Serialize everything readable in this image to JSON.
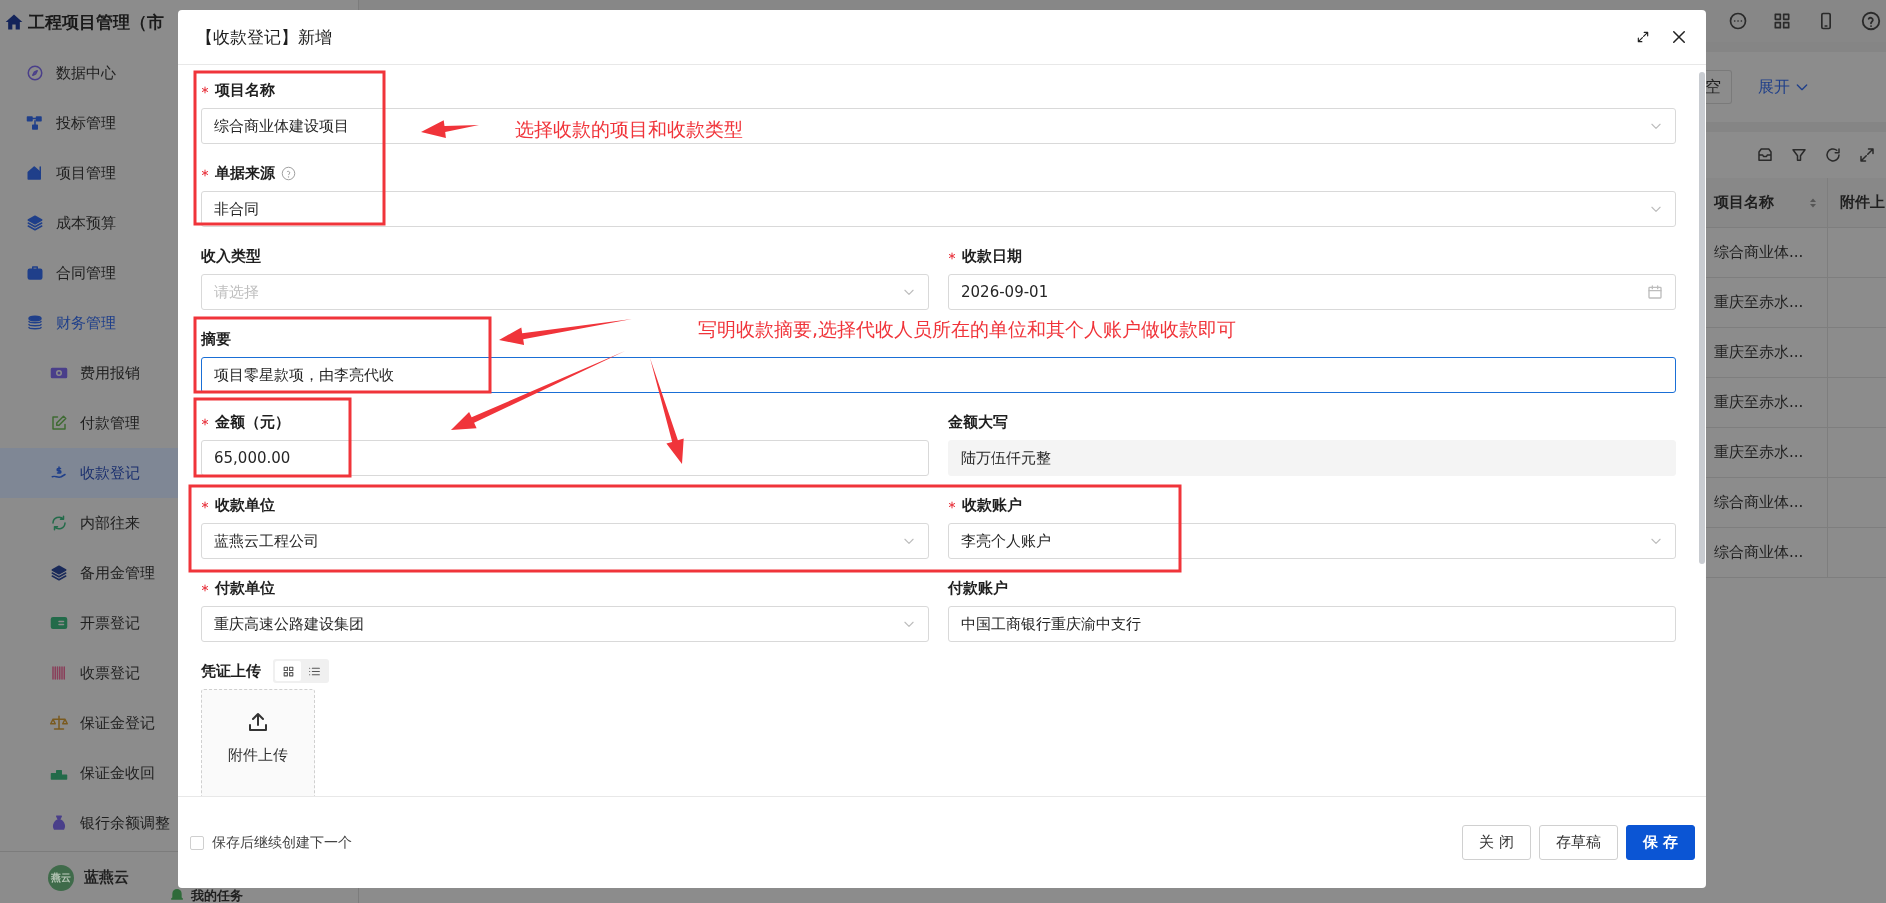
{
  "app": {
    "title": "工程项目管理（市",
    "nav": [
      {
        "label": "数据中心",
        "expanded": false,
        "selected": false
      },
      {
        "label": "投标管理",
        "expanded": false,
        "selected": false
      },
      {
        "label": "项目管理",
        "expanded": false,
        "selected": false
      },
      {
        "label": "成本预算",
        "expanded": false,
        "selected": false
      },
      {
        "label": "合同管理",
        "expanded": false,
        "selected": false
      },
      {
        "label": "财务管理",
        "expanded": true,
        "selected": false,
        "children": [
          {
            "label": "费用报销",
            "selected": false
          },
          {
            "label": "付款管理",
            "selected": false
          },
          {
            "label": "收款登记",
            "selected": true
          },
          {
            "label": "内部往来",
            "selected": false
          },
          {
            "label": "备用金管理",
            "selected": false
          },
          {
            "label": "开票登记",
            "selected": false
          },
          {
            "label": "收票登记",
            "selected": false
          },
          {
            "label": "保证金登记",
            "selected": false
          },
          {
            "label": "保证金收回",
            "selected": false
          },
          {
            "label": "银行余额调整",
            "selected": false
          }
        ]
      }
    ],
    "user": {
      "avatar": "燕云",
      "name": "蓝燕云"
    },
    "tasks_link": "我的任务"
  },
  "background_page": {
    "filter_button": "空",
    "expand_link": "展开",
    "table": {
      "columns": [
        {
          "label": "项目名称",
          "sortable": true
        },
        {
          "label": "附件上"
        }
      ],
      "rows": [
        [
          "综合商业体..."
        ],
        [
          "重庆至赤水..."
        ],
        [
          "重庆至赤水..."
        ],
        [
          "重庆至赤水..."
        ],
        [
          "重庆至赤水..."
        ],
        [
          "综合商业体..."
        ],
        [
          "综合商业体..."
        ]
      ]
    }
  },
  "dialog": {
    "title": "【收款登记】新增",
    "fields": [
      {
        "label": "项目名称",
        "required": true,
        "help": false,
        "kind": "select",
        "wide": true,
        "focused": false,
        "value": "综合商业体建设项目"
      },
      {
        "label": "单据来源",
        "required": true,
        "help": true,
        "kind": "select",
        "wide": true,
        "focused": false,
        "value": "非合同"
      },
      {
        "label": "收入类型",
        "required": false,
        "help": false,
        "kind": "select",
        "wide": false,
        "focused": false,
        "placeholder": "请选择"
      },
      {
        "label": "收款日期",
        "required": true,
        "help": false,
        "kind": "date",
        "wide": false,
        "focused": false,
        "value": "2026-09-01"
      },
      {
        "label": "摘要",
        "required": false,
        "help": false,
        "kind": "text",
        "wide": true,
        "focused": true,
        "value": "项目零星款项，由李亮代收"
      },
      {
        "label": "金额（元）",
        "required": true,
        "help": false,
        "kind": "text",
        "wide": false,
        "focused": false,
        "value": "65,000.00"
      },
      {
        "label": "金额大写",
        "required": false,
        "help": false,
        "kind": "readonly",
        "wide": false,
        "focused": false,
        "value": "陆万伍仟元整"
      },
      {
        "label": "收款单位",
        "required": true,
        "help": false,
        "kind": "select",
        "wide": false,
        "focused": false,
        "value": "蓝燕云工程公司"
      },
      {
        "label": "收款账户",
        "required": true,
        "help": false,
        "kind": "select",
        "wide": false,
        "focused": false,
        "value": "李亮个人账户"
      },
      {
        "label": "付款单位",
        "required": true,
        "help": false,
        "kind": "select",
        "wide": false,
        "focused": false,
        "value": "重庆高速公路建设集团"
      },
      {
        "label": "付款账户",
        "required": false,
        "help": false,
        "kind": "text",
        "wide": false,
        "focused": false,
        "value": "中国工商银行重庆渝中支行"
      }
    ],
    "upload": {
      "label": "凭证上传",
      "view_modes": [
        {
          "kind": "grid",
          "selected": true
        },
        {
          "kind": "list",
          "selected": false
        }
      ],
      "button": "附件上传"
    },
    "continue_checkbox": {
      "label": "保存后继续创建下一个",
      "checked": false
    },
    "buttons": [
      {
        "label": "关 闭",
        "kind": "default"
      },
      {
        "label": "存草稿",
        "kind": "default"
      },
      {
        "label": "保 存",
        "kind": "primary"
      }
    ]
  },
  "annotations": {
    "notes": [
      "选择收款的项目和收款类型",
      "写明收款摘要,选择代收人员所在的单位和其个人账户做收款即可"
    ]
  }
}
